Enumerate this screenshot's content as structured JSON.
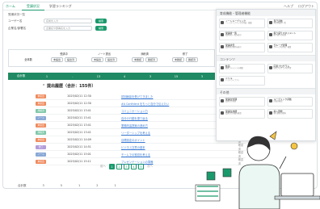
{
  "topbar": {
    "home": "ホーム",
    "tabs": [
      "受講状況",
      "学習ランキング"
    ],
    "right": [
      "ヘルプ",
      "ログアウト"
    ]
  },
  "sub": {
    "text": "受講状況一覧"
  },
  "filters": {
    "row1": {
      "label": "ユーザー名",
      "placeholder": "名前を入力",
      "button": "検索"
    },
    "row2": {
      "label": "企業名/部署名",
      "placeholder": "企業名や部署名を入力",
      "button": "検索"
    }
  },
  "summary": {
    "label": "全体数",
    "cols": [
      {
        "name": "受講中",
        "a": "未提出",
        "b": "提出済"
      },
      {
        "name": "ノート提出",
        "a": "未提出",
        "b": "提出済"
      },
      {
        "name": "添削済",
        "a": "未確認",
        "b": "確認済"
      },
      {
        "name": "修了",
        "a": "未確認",
        "b": "確認済"
      }
    ],
    "bar": [
      "合計数",
      "1",
      "-",
      "13",
      "4",
      "3",
      "15",
      "3"
    ]
  },
  "list": {
    "heading": "提出履歴（合計：155件）",
    "rows": [
      {
        "badge": "未提出",
        "color": "#f08a5d",
        "date": "2025/02/11 12:30",
        "title": "初回面談を受けてきました",
        "status": "未確認"
      },
      {
        "badge": "未提出",
        "color": "#f08a5d",
        "date": "2025/02/11 12:30",
        "title": "#A Confident をもっと自分で伝えたい",
        "status": "未確認"
      },
      {
        "badge": "添削済",
        "color": "#7fc8a9",
        "date": "2025/02/11 13:41",
        "title": "コミュニケーション力",
        "status": "確認済"
      },
      {
        "badge": "ノート",
        "color": "#8aa9d6",
        "date": "2025/02/11 13:41",
        "title": "自分の行動を振り返る",
        "status": "確認済"
      },
      {
        "badge": "未提出",
        "color": "#f08a5d",
        "date": "2025/02/11 13:41",
        "title": "業務改善提案の進め方",
        "status": "確認済"
      },
      {
        "badge": "添削済",
        "color": "#7fc8a9",
        "date": "2025/02/11 13:41",
        "title": "リーダーシップを考える",
        "status": "確認済"
      },
      {
        "badge": "未提出",
        "color": "#f08a5d",
        "date": "2025/02/11 14:09",
        "title": "目標設定のポイント",
        "status": "確認済"
      },
      {
        "badge": "修了",
        "color": "#b39ddb",
        "date": "2025/02/11 14:51",
        "title": "ビジネス文章の基本",
        "status": "確認済"
      },
      {
        "badge": "ノート",
        "color": "#8aa9d6",
        "date": "2025/02/11 15:01",
        "title": "チームでの役割を考える",
        "status": "確認済"
      },
      {
        "badge": "未提出",
        "color": "#f08a5d",
        "date": "2025/02/11 15:11",
        "title": "プレゼンテーションの準備",
        "status": "確認済"
      }
    ]
  },
  "pager": {
    "prev": "前へ",
    "pages": [
      "1",
      "2",
      "3",
      "4",
      "5"
    ],
    "next": "次へ"
  },
  "bottomrow": [
    "合計数",
    "3",
    "5",
    "1",
    "2",
    "1"
  ],
  "menu": {
    "sec1": "育成機能・管理者機能",
    "cards1": [
      {
        "t": "ノートルーブリック",
        "d": "ノートルーブリックの作成・編集"
      },
      {
        "t": "自己評価",
        "d": "自己評価の一覧"
      },
      {
        "t": "受講者一覧",
        "d": "受講者の一覧を表示"
      },
      {
        "t": "振り返りマネジメント",
        "d": "振り返りの管理"
      },
      {
        "t": "受講状況",
        "d": "受講者の進捗を表示"
      },
      {
        "t": "グループ管理",
        "d": "グループの作成・編集"
      }
    ],
    "sec2": "コンテンツ",
    "cards2": [
      {
        "t": "動画",
        "d": "動画コンテンツの視聴"
      },
      {
        "t": "応用プログラム",
        "d": "応用プログラムの学習"
      },
      {
        "t": "ドリル",
        "d": "ドリルライブラリ"
      }
    ],
    "sec3": "その他",
    "cards3": [
      {
        "t": "受講生管理",
        "d": "受講生の管理"
      },
      {
        "t": "ルーブリック評価",
        "d": "評価を確認"
      },
      {
        "t": "受講生詳細",
        "d": "受講生の詳細を確認"
      },
      {
        "t": "導入研修",
        "d": "導入研修の資料"
      }
    ]
  }
}
